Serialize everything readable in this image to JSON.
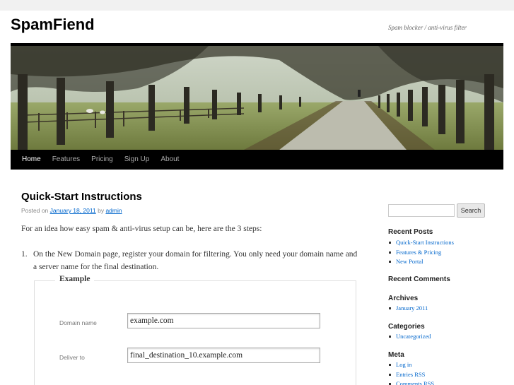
{
  "site": {
    "title": "SpamFiend",
    "description": "Spam blocker / anti-virus filter"
  },
  "nav": {
    "items": [
      "Home",
      "Features",
      "Pricing",
      "Sign Up",
      "About"
    ]
  },
  "post": {
    "title": "Quick-Start Instructions",
    "meta_prefix": "Posted on",
    "date": "January 18, 2011",
    "meta_by": "by",
    "author": "admin",
    "intro": "For an idea how easy spam & anti-virus setup can be, here are the 3 steps:",
    "step1_number": "1.",
    "step1_text": "On the New Domain page, register your domain for filtering. You only need your domain name and a server name for the final destination."
  },
  "example_form": {
    "legend": "Example",
    "domain_label": "Domain name",
    "domain_value": "example.com",
    "deliver_label": "Deliver to",
    "deliver_value": "final_destination_10.example.com"
  },
  "sidebar": {
    "search_button": "Search",
    "recent_posts_title": "Recent Posts",
    "recent_posts": [
      "Quick-Start Instructions",
      "Features & Pricing",
      "New Portal"
    ],
    "recent_comments_title": "Recent Comments",
    "archives_title": "Archives",
    "archives": [
      "January 2011"
    ],
    "categories_title": "Categories",
    "categories": [
      "Uncategorized"
    ],
    "meta_title": "Meta",
    "meta_links": [
      "Log in",
      "Entries RSS",
      "Comments RSS"
    ]
  },
  "colors": {
    "background": "#f1f1f1",
    "link": "#0066cc",
    "nav_bar": "#000000"
  }
}
